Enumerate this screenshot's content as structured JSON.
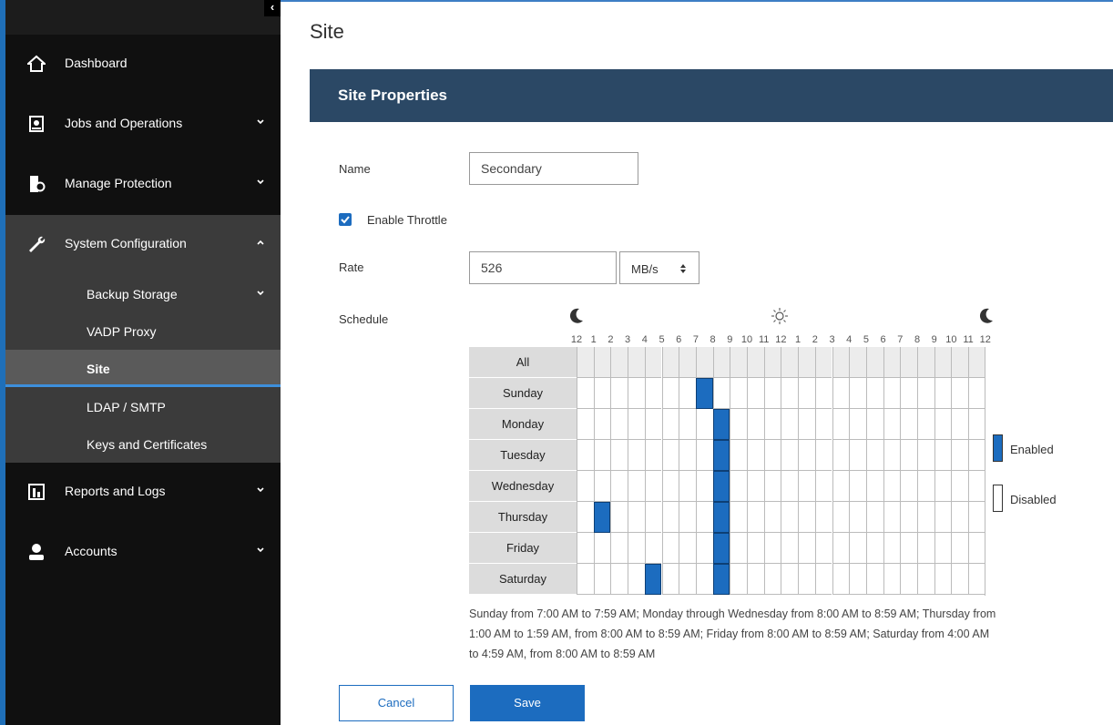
{
  "sidebar": {
    "collapse_glyph": "‹",
    "nav": [
      {
        "label": "Dashboard",
        "icon": "home-icon"
      },
      {
        "label": "Jobs and Operations",
        "icon": "jobs-icon"
      },
      {
        "label": "Manage Protection",
        "icon": "protection-icon"
      },
      {
        "label": "System Configuration",
        "icon": "wrench-icon"
      },
      {
        "label": "Reports and Logs",
        "icon": "reports-icon"
      },
      {
        "label": "Accounts",
        "icon": "user-icon"
      }
    ],
    "sub_items": [
      {
        "label": "Backup Storage"
      },
      {
        "label": "VADP Proxy"
      },
      {
        "label": "Site"
      },
      {
        "label": "LDAP / SMTP"
      },
      {
        "label": "Keys and Certificates"
      }
    ]
  },
  "page": {
    "title": "Site"
  },
  "panel": {
    "title": "Site Properties"
  },
  "form": {
    "name_label": "Name",
    "name_value": "Secondary",
    "throttle_label": "Enable Throttle",
    "throttle_checked": true,
    "rate_label": "Rate",
    "rate_value": "526",
    "rate_unit": "MB/s",
    "schedule_label": "Schedule"
  },
  "schedule": {
    "hours": [
      "12",
      "1",
      "2",
      "3",
      "4",
      "5",
      "6",
      "7",
      "8",
      "9",
      "10",
      "11",
      "12",
      "1",
      "2",
      "3",
      "4",
      "5",
      "6",
      "7",
      "8",
      "9",
      "10",
      "11",
      "12"
    ],
    "rows": [
      {
        "label": "All",
        "on": []
      },
      {
        "label": "Sunday",
        "on": [
          7
        ]
      },
      {
        "label": "Monday",
        "on": [
          8
        ]
      },
      {
        "label": "Tuesday",
        "on": [
          8
        ]
      },
      {
        "label": "Wednesday",
        "on": [
          8
        ]
      },
      {
        "label": "Thursday",
        "on": [
          1,
          8
        ]
      },
      {
        "label": "Friday",
        "on": [
          8
        ]
      },
      {
        "label": "Saturday",
        "on": [
          4,
          8
        ]
      }
    ],
    "enabled_color": "#1c6cbf"
  },
  "legend": {
    "enabled": "Enabled",
    "disabled": "Disabled"
  },
  "summary": "Sunday from 7:00 AM to 7:59 AM; Monday through Wednesday from 8:00 AM to 8:59 AM; Thursday from 1:00 AM to 1:59 AM, from 8:00 AM to 8:59 AM; Friday from 8:00 AM to 8:59 AM; Saturday from 4:00 AM to 4:59 AM, from 8:00 AM to 8:59 AM",
  "buttons": {
    "cancel": "Cancel",
    "save": "Save"
  }
}
